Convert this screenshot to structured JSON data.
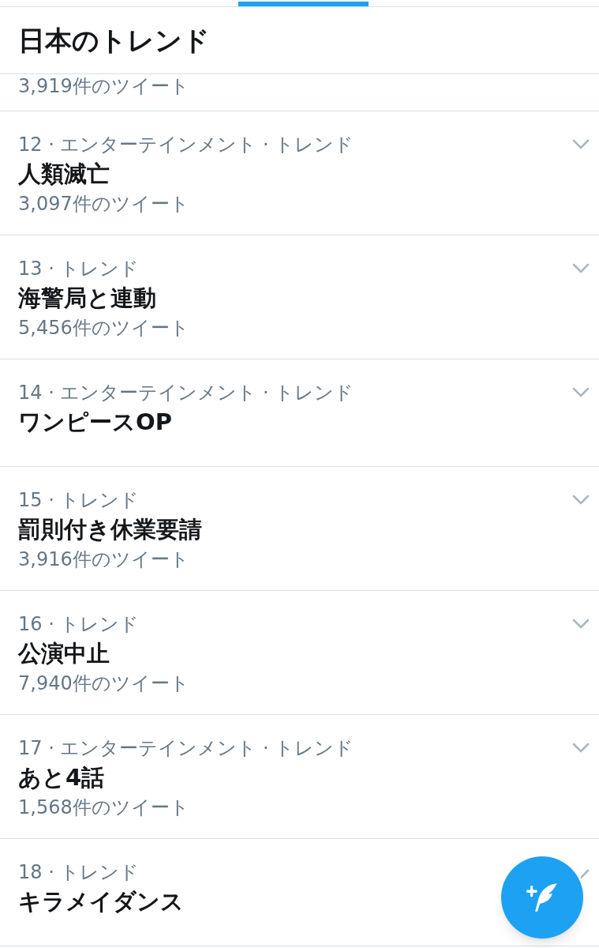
{
  "header": {
    "title": "日本のトレンド"
  },
  "previous_item_tail": {
    "tweet_count": "3,919件のツイート"
  },
  "trends": [
    {
      "meta": "12 · エンターテインメント · トレンド",
      "name": "人類滅亡",
      "tweet_count": "3,097件のツイート"
    },
    {
      "meta": "13 · トレンド",
      "name": "海警局と連動",
      "tweet_count": "5,456件のツイート"
    },
    {
      "meta": "14 · エンターテインメント · トレンド",
      "name": "ワンピースOP"
    },
    {
      "meta": "15 · トレンド",
      "name": "罰則付き休業要請",
      "tweet_count": "3,916件のツイート"
    },
    {
      "meta": "16 · トレンド",
      "name": "公演中止",
      "tweet_count": "7,940件のツイート"
    },
    {
      "meta": "17 · エンターテインメント · トレンド",
      "name": "あと4話",
      "tweet_count": "1,568件のツイート"
    },
    {
      "meta": "18 · トレンド",
      "name": "キラメイダンス"
    }
  ]
}
